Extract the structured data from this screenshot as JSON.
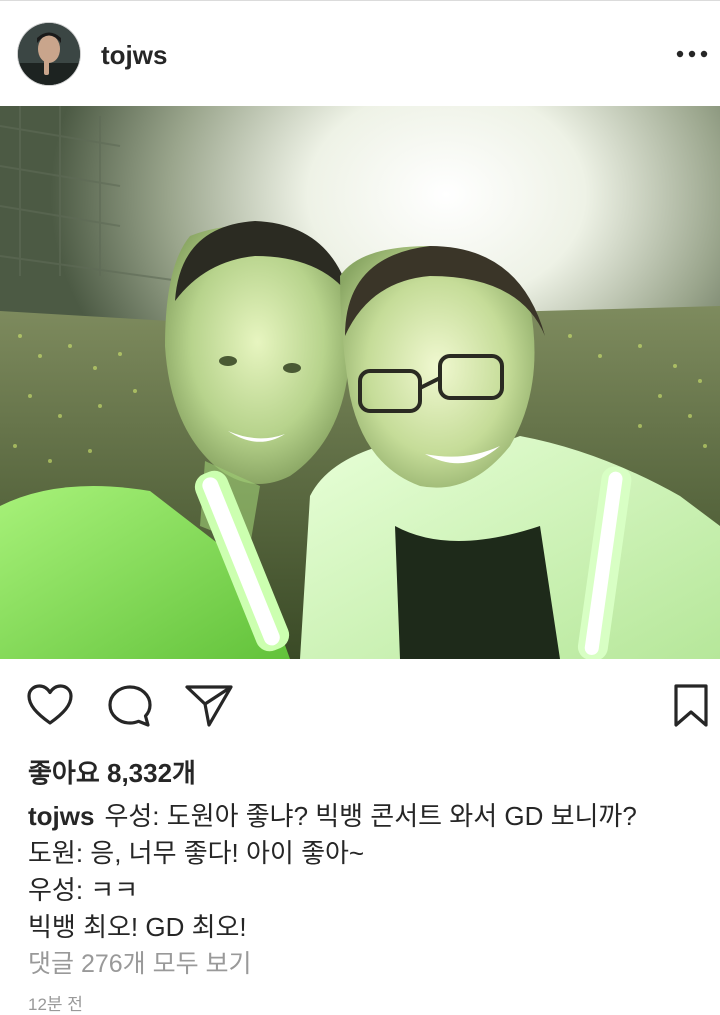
{
  "post": {
    "username": "tojws",
    "likes_text": "좋아요 8,332개",
    "caption": {
      "author": "tojws",
      "lines": [
        "우성: 도원아 좋냐? 빅뱅 콘서트 와서 GD 보니까?",
        "도원: 응, 너무 좋다! 아이 좋아~",
        "우성: ㅋㅋ",
        "빅뱅 최오! GD 최오!"
      ]
    },
    "view_comments": "댓글 276개 모두 보기",
    "timestamp": "12분 전"
  },
  "icons": {
    "more": "more-horizontal-icon",
    "like": "heart-icon",
    "comment": "comment-icon",
    "share": "paper-plane-icon",
    "save": "bookmark-icon"
  },
  "colors": {
    "text": "#262626",
    "muted": "#999999",
    "divider": "#dbdbdb",
    "lightstick_green": "#7dff3a"
  }
}
